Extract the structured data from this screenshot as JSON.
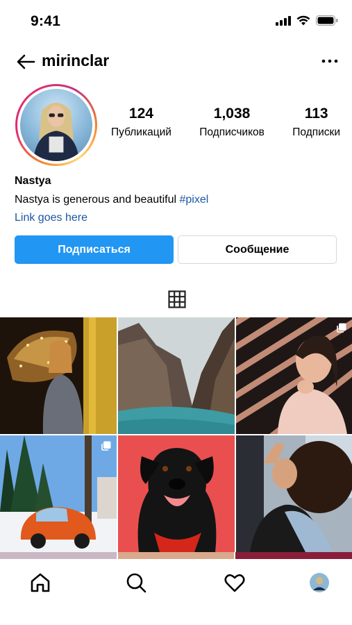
{
  "status_bar": {
    "time": "9:41",
    "icons": [
      "cellular-signal-icon",
      "wifi-icon",
      "battery-icon"
    ]
  },
  "header": {
    "back_icon": "arrow-left-icon",
    "username": "mirinclar",
    "more_icon": "more-horizontal-icon"
  },
  "profile": {
    "avatar_icon": "profile-avatar",
    "stats": [
      {
        "value": "124",
        "label": "Публикаций"
      },
      {
        "value": "1,038",
        "label": "Подписчиков"
      },
      {
        "value": "113",
        "label": "Подписки"
      }
    ],
    "name": "Nastya",
    "bio_text": "Nastya is generous and beautiful ",
    "bio_tag": "#pixel",
    "link": "Link goes here"
  },
  "actions": {
    "follow_label": "Подписаться",
    "message_label": "Сообщение"
  },
  "colors": {
    "accent": "#2196f3",
    "link": "#1c56a3"
  },
  "tabs": {
    "grid_icon": "grid-icon"
  },
  "posts": [
    {
      "subject": "woman-with-umbrella-lights",
      "multiple": false
    },
    {
      "subject": "mountain-lake",
      "multiple": false
    },
    {
      "subject": "woman-striped-wall",
      "multiple": true
    },
    {
      "subject": "orange-beetle-car",
      "multiple": true
    },
    {
      "subject": "black-dog",
      "multiple": false
    },
    {
      "subject": "curly-hair-woman",
      "multiple": false
    }
  ],
  "bottom_nav": [
    {
      "icon": "home-icon"
    },
    {
      "icon": "search-icon"
    },
    {
      "icon": "heart-icon"
    },
    {
      "icon": "profile-avatar-icon"
    }
  ]
}
